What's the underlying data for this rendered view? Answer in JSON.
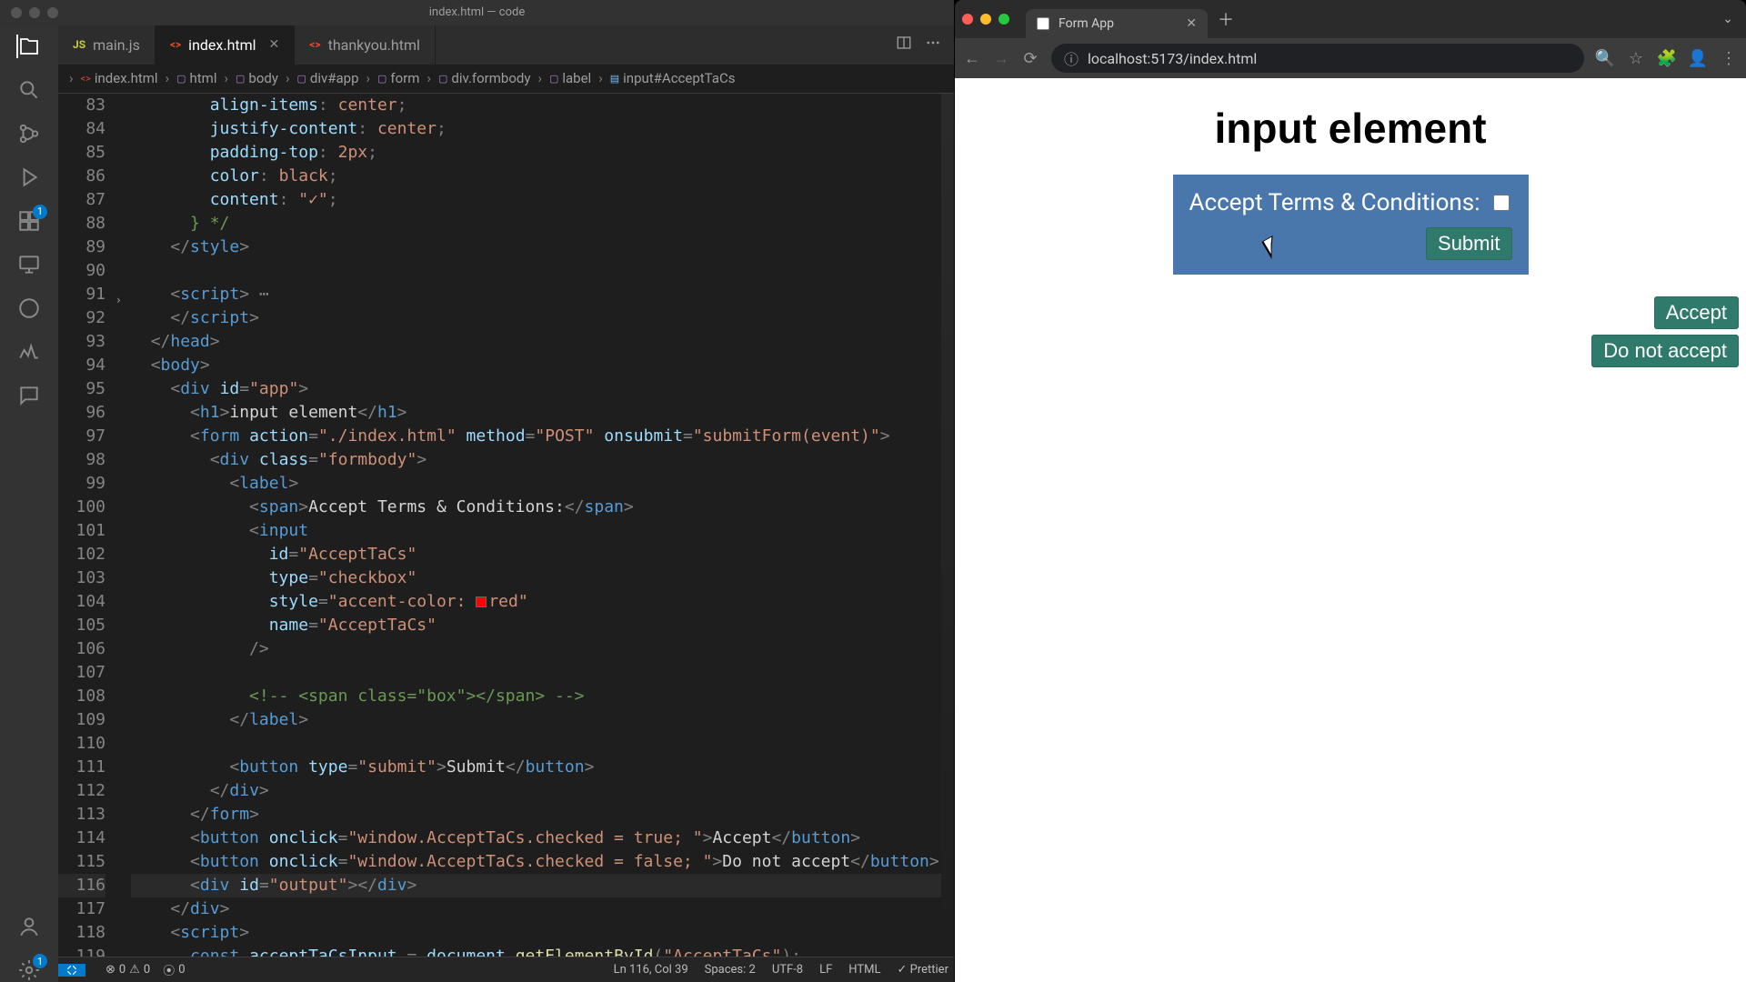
{
  "vscode": {
    "window_title": "index.html — code",
    "activitybar": {
      "items": [
        {
          "name": "explorer",
          "active": true
        },
        {
          "name": "search"
        },
        {
          "name": "scm"
        },
        {
          "name": "debug"
        },
        {
          "name": "extensions",
          "badge": "1"
        },
        {
          "name": "remote"
        },
        {
          "name": "cloud"
        },
        {
          "name": "monitor"
        },
        {
          "name": "chat"
        }
      ],
      "bottom": [
        {
          "name": "account"
        },
        {
          "name": "settings",
          "badge": "1"
        }
      ]
    },
    "tabs": [
      {
        "label": "main.js",
        "icon": "js",
        "active": false
      },
      {
        "label": "index.html",
        "icon": "html",
        "active": true,
        "closable": true
      },
      {
        "label": "thankyou.html",
        "icon": "html",
        "active": false
      }
    ],
    "breadcrumb": [
      {
        "label": "index.html",
        "ico": "html"
      },
      {
        "label": "html",
        "ico": "cube"
      },
      {
        "label": "body",
        "ico": "cube"
      },
      {
        "label": "div#app",
        "ico": "cube"
      },
      {
        "label": "form",
        "ico": "cube"
      },
      {
        "label": "div.formbody",
        "ico": "cube"
      },
      {
        "label": "label",
        "ico": "cube"
      },
      {
        "label": "input#AcceptTaCs",
        "ico": "field"
      }
    ],
    "editor": {
      "first_line_number": 83,
      "highlight_line_number": 116,
      "folded_line_number": 91,
      "cursor": {
        "line": 116,
        "col": 39
      },
      "accent_color_value": "red",
      "accent_color_swatch": "#ff0000"
    },
    "statusbar": {
      "errors": "0",
      "warnings": "0",
      "ports": "0",
      "cursor": "Ln 116, Col 39",
      "spaces": "Spaces: 2",
      "encoding": "UTF-8",
      "eol": "LF",
      "language": "HTML",
      "formatter": "Prettier"
    }
  },
  "browser": {
    "tab_title": "Form App",
    "url": "localhost:5173/index.html",
    "page": {
      "heading": "input element",
      "checkbox_label": "Accept Terms & Conditions:",
      "submit_label": "Submit",
      "accept_label": "Accept",
      "reject_label": "Do not accept"
    }
  }
}
